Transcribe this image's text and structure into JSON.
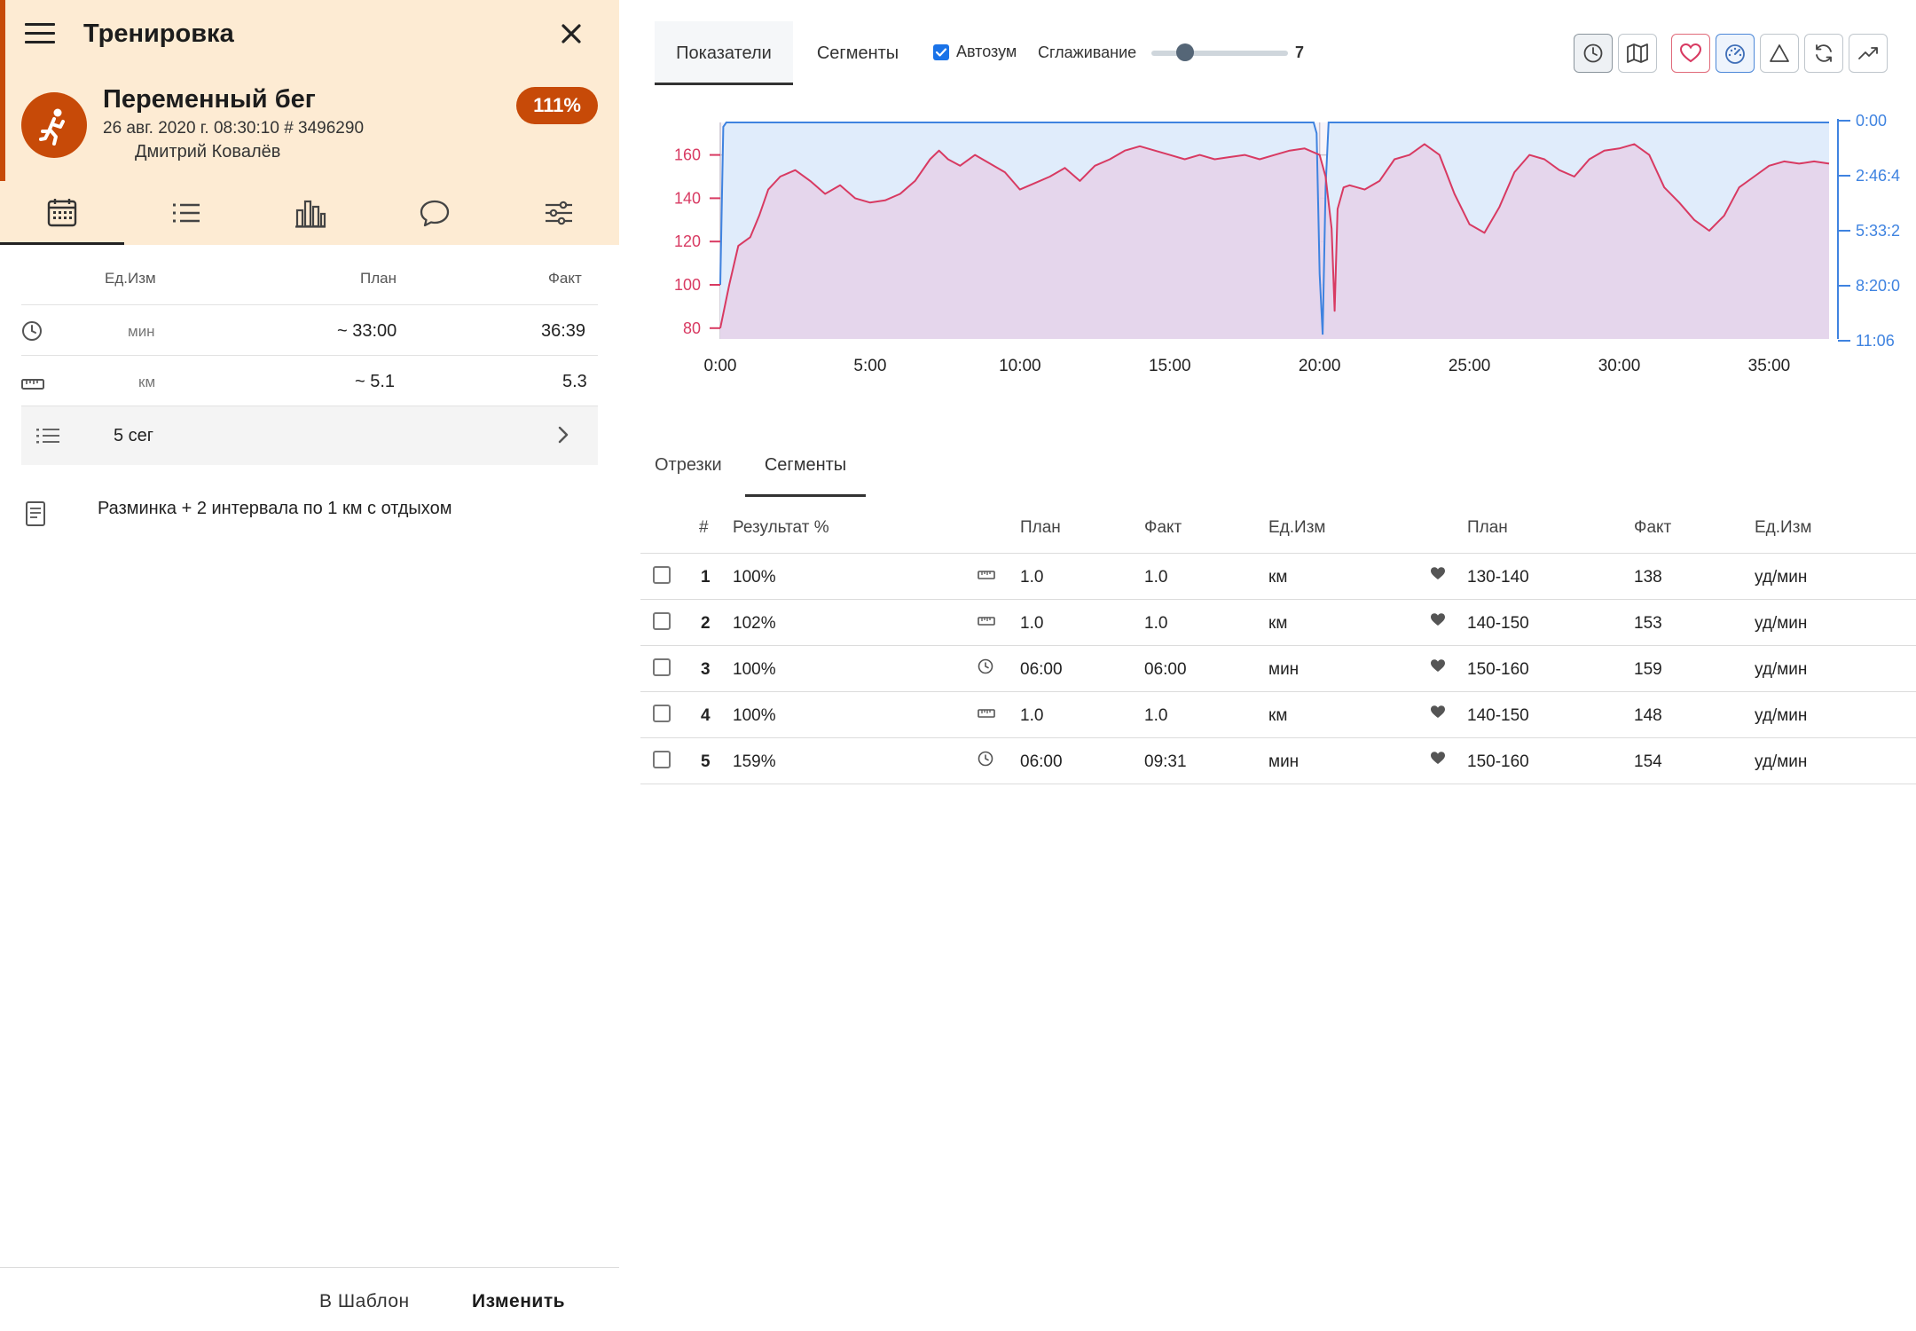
{
  "header": {
    "title": "Тренировка",
    "workout_name": "Переменный бег",
    "date_id": "26 авг. 2020 г. 08:30:10 # 3496290",
    "athlete": "Дмитрий Ковалёв",
    "completion": "111%",
    "accent_color": "#c74a08",
    "background_color": "#fdebd3"
  },
  "left_tabs": [
    "calendar-icon",
    "list-icon",
    "bar-chart-icon",
    "chat-icon",
    "sliders-icon"
  ],
  "metrics": {
    "headers": {
      "unit": "Ед.Изм",
      "plan": "План",
      "fact": "Факт"
    },
    "rows": [
      {
        "icon": "clock-icon",
        "unit": "мин",
        "plan": "~ 33:00",
        "fact": "36:39"
      },
      {
        "icon": "ruler-icon",
        "unit": "км",
        "plan": "~ 5.1",
        "fact": "5.3"
      }
    ],
    "segments_label": "5 сег"
  },
  "note": "Разминка + 2 интервала по 1 км с отдыхом",
  "footer": {
    "template": "В Шаблон",
    "edit": "Изменить"
  },
  "right": {
    "tabs": [
      "Показатели",
      "Сегменты"
    ],
    "autozoom_label": "Автозум",
    "smoothing_label": "Сглаживание",
    "smoothing_value": "7",
    "tools": [
      "clock-icon",
      "map-icon",
      "heart-icon",
      "speedometer-icon",
      "triangle-icon",
      "refresh-icon",
      "trend-icon"
    ]
  },
  "chart_data": {
    "type": "area",
    "x_ticks": [
      "0:00",
      "5:00",
      "10:00",
      "15:00",
      "20:00",
      "25:00",
      "30:00",
      "35:00"
    ],
    "xlim_min": [
      0,
      37
    ],
    "y_left_ticks": [
      "80",
      "100",
      "120",
      "140",
      "160"
    ],
    "y_left_range": [
      75,
      175
    ],
    "y_right_ticks": [
      "0:00",
      "2:46:4",
      "5:33:2",
      "8:20:0",
      "11:06"
    ],
    "series": [
      {
        "color": "#d83a62",
        "x": [
          0,
          0.3,
          0.6,
          1,
          1.3,
          1.6,
          2,
          2.5,
          3,
          3.5,
          4,
          4.5,
          5,
          5.5,
          6,
          6.5,
          7,
          7.3,
          7.6,
          8,
          8.5,
          9,
          9.5,
          10,
          10.5,
          11,
          11.5,
          12,
          12.5,
          13,
          13.5,
          14,
          14.5,
          15,
          15.5,
          16,
          16.5,
          17,
          17.5,
          18,
          18.5,
          19,
          19.5,
          20,
          20.2,
          20.4,
          20.5,
          20.6,
          20.8,
          21,
          21.5,
          22,
          22.5,
          23,
          23.5,
          24,
          24.5,
          25,
          25.5,
          26,
          26.5,
          27,
          27.5,
          28,
          28.5,
          29,
          29.5,
          30,
          30.5,
          31,
          31.5,
          32,
          32.5,
          33,
          33.5,
          34,
          34.5,
          35,
          35.5,
          36,
          36.5,
          37
        ],
        "y": [
          80,
          100,
          118,
          122,
          132,
          144,
          150,
          153,
          148,
          142,
          146,
          140,
          138,
          139,
          142,
          148,
          158,
          162,
          158,
          155,
          160,
          156,
          152,
          144,
          147,
          150,
          154,
          148,
          155,
          158,
          162,
          164,
          162,
          160,
          158,
          160,
          158,
          159,
          160,
          158,
          160,
          162,
          163,
          160,
          150,
          126,
          88,
          135,
          145,
          146,
          144,
          148,
          158,
          160,
          165,
          160,
          142,
          128,
          124,
          136,
          152,
          160,
          158,
          153,
          150,
          158,
          162,
          163,
          165,
          160,
          145,
          138,
          130,
          125,
          132,
          145,
          150,
          155,
          157,
          156,
          157,
          156
        ],
        "fill": "#e5d4ea"
      },
      {
        "color": "#3f83e0",
        "x": [
          0,
          0.1,
          0.2,
          5,
          10,
          15,
          19.8,
          19.9,
          20,
          20.1,
          20.2,
          20.3,
          30,
          37
        ],
        "y_norm": [
          0.75,
          0.02,
          0.0,
          0.0,
          0.0,
          0.0,
          0.0,
          0.05,
          0.7,
          0.98,
          0.3,
          0.0,
          0.0,
          0.0
        ],
        "fill": "#e0ecfb"
      }
    ]
  },
  "sub_tabs": [
    "Отрезки",
    "Сегменты"
  ],
  "segments_table": {
    "headers": [
      "#",
      "Результат %",
      "План",
      "Факт",
      "Ед.Изм",
      "План",
      "Факт",
      "Ед.Изм"
    ],
    "rows": [
      {
        "n": "1",
        "result": "100%",
        "icon": "ruler-icon",
        "plan": "1.0",
        "fact": "1.0",
        "unit": "км",
        "hr_plan": "130-140",
        "hr_fact": "138",
        "hr_unit": "уд/мин"
      },
      {
        "n": "2",
        "result": "102%",
        "icon": "ruler-icon",
        "plan": "1.0",
        "fact": "1.0",
        "unit": "км",
        "hr_plan": "140-150",
        "hr_fact": "153",
        "hr_unit": "уд/мин"
      },
      {
        "n": "3",
        "result": "100%",
        "icon": "clock-icon",
        "plan": "06:00",
        "fact": "06:00",
        "unit": "мин",
        "hr_plan": "150-160",
        "hr_fact": "159",
        "hr_unit": "уд/мин"
      },
      {
        "n": "4",
        "result": "100%",
        "icon": "ruler-icon",
        "plan": "1.0",
        "fact": "1.0",
        "unit": "км",
        "hr_plan": "140-150",
        "hr_fact": "148",
        "hr_unit": "уд/мин"
      },
      {
        "n": "5",
        "result": "159%",
        "icon": "clock-icon",
        "plan": "06:00",
        "fact": "09:31",
        "unit": "мин",
        "hr_plan": "150-160",
        "hr_fact": "154",
        "hr_unit": "уд/мин"
      }
    ]
  }
}
